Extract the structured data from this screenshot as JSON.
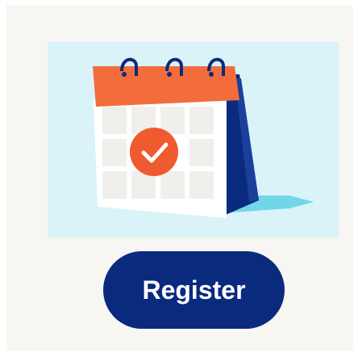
{
  "hero": {
    "illustration_icon": "calendar-check-icon",
    "colors": {
      "background": "#d9f3f9",
      "calendar_header": "#f26d3b",
      "check_circle": "#ef5a2e",
      "calendar_back": "#0a2a7e",
      "ring": "#0a2a7e",
      "shadow": "#5fd0e6"
    }
  },
  "cta": {
    "label": "Register",
    "background": "#0a2a7e",
    "text_color": "#ffffff"
  }
}
